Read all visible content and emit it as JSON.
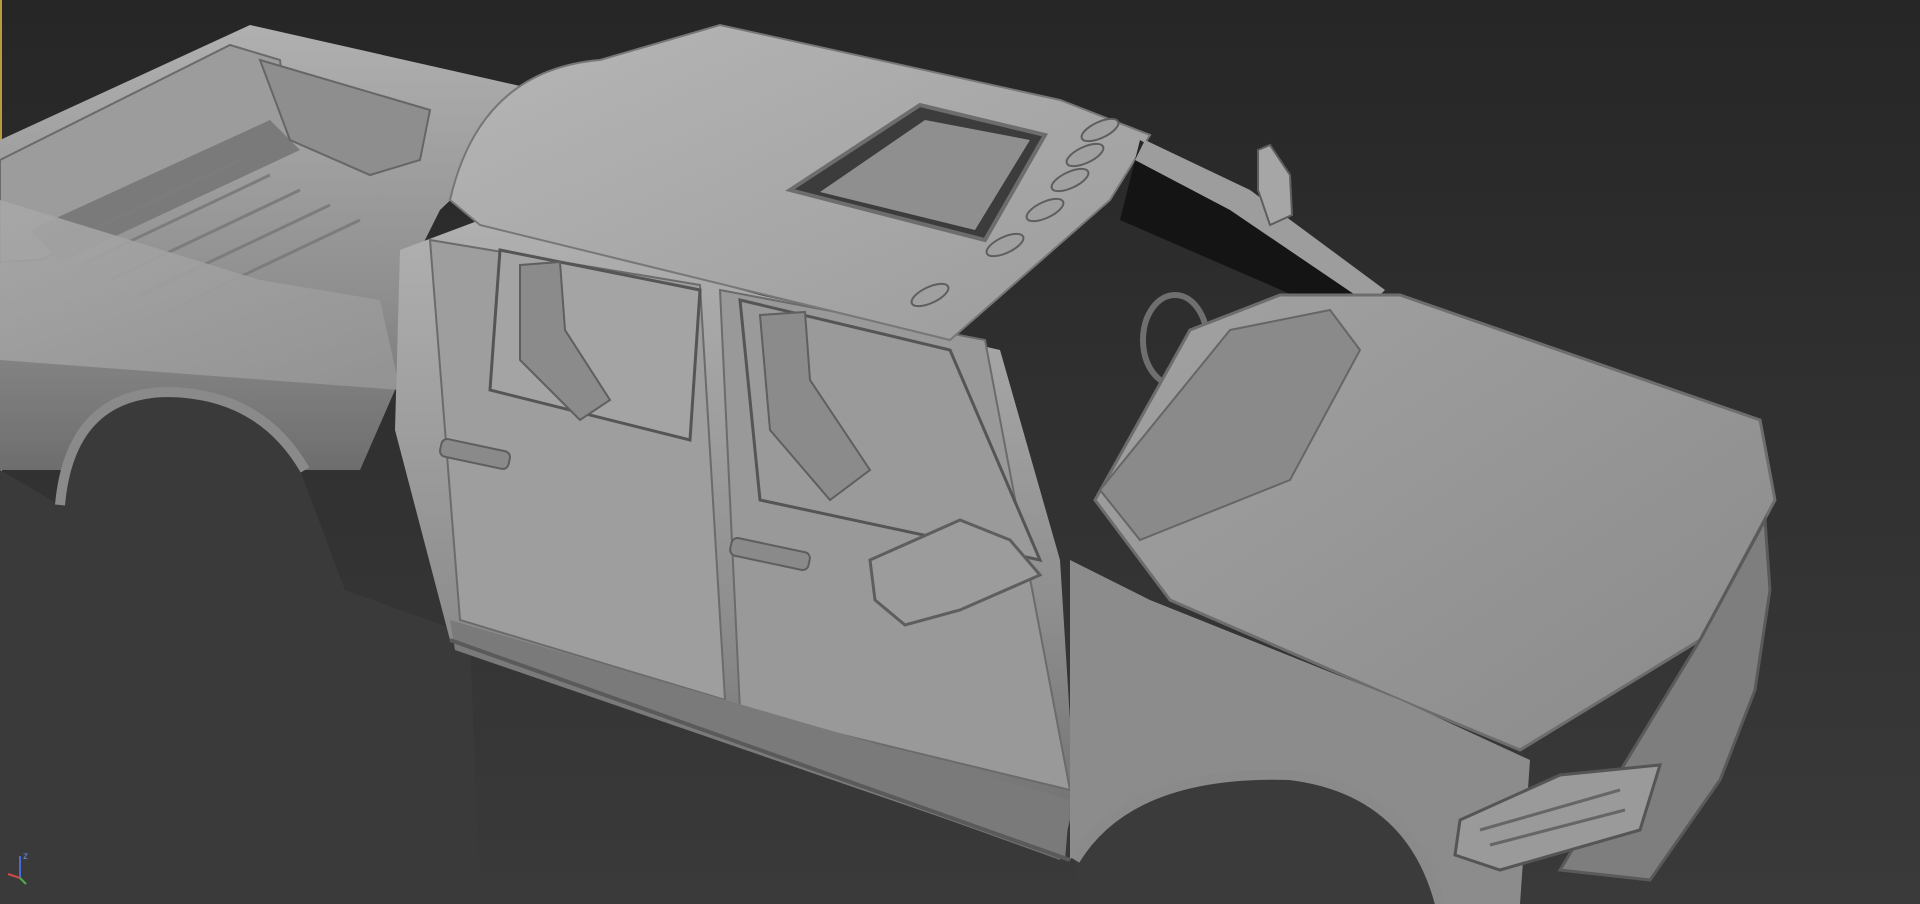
{
  "viewport": {
    "view": "perspective",
    "shading": "default-shading-grey",
    "background_color": "#2b2b2b",
    "active_border_color": "#b89b3a"
  },
  "model": {
    "subject": "pickup-truck-body-mesh",
    "material_color": "#9a9a9a",
    "shadow_color": "#4a4a4a",
    "highlight_color": "#bcbcbc"
  },
  "axis_gizmo": {
    "x_color": "#d04a4a",
    "y_color": "#4ab04a",
    "z_color": "#4a6ad0",
    "z_label": "z"
  }
}
